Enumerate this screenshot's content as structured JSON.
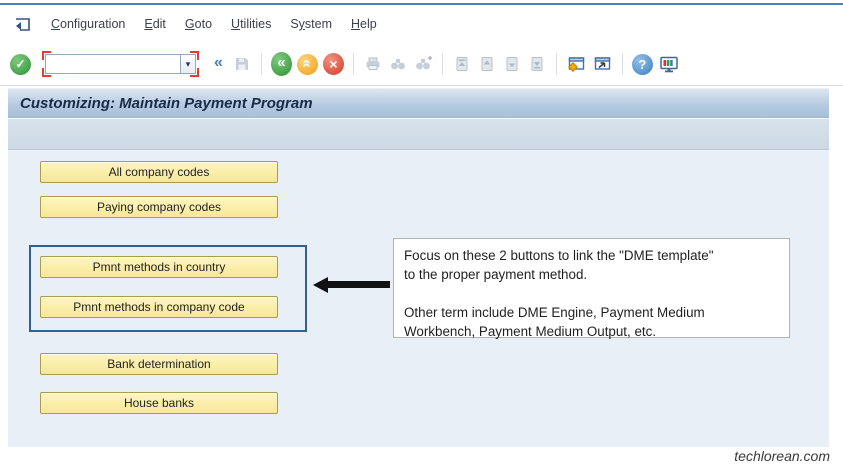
{
  "menu_bar": {
    "items": [
      {
        "pre": "",
        "key": "C",
        "post": "onfiguration"
      },
      {
        "pre": "",
        "key": "E",
        "post": "dit"
      },
      {
        "pre": "",
        "key": "G",
        "post": "oto"
      },
      {
        "pre": "",
        "key": "U",
        "post": "tilities"
      },
      {
        "pre": "S",
        "key": "y",
        "post": "stem"
      },
      {
        "pre": "",
        "key": "H",
        "post": "elp"
      }
    ]
  },
  "toolbar": {
    "command_field": {
      "value": ""
    },
    "glyphs": {
      "check": "✓",
      "chevrons_left": "«",
      "cross": "×",
      "question": "?",
      "dropdown": "▾"
    },
    "icon_names": [
      "enter",
      "command-field",
      "collapse",
      "save",
      "back",
      "exit",
      "cancel",
      "print",
      "find",
      "find-next",
      "first-page",
      "previous-page",
      "next-page",
      "last-page",
      "new-session",
      "create-shortcut",
      "help",
      "customize-layout"
    ]
  },
  "title_bar": {
    "title": "Customizing: Maintain Payment Program"
  },
  "content": {
    "buttons": [
      {
        "label": "All company codes",
        "highlighted": false
      },
      {
        "label": "Paying company codes",
        "highlighted": false
      },
      {
        "label": "Pmnt methods in country",
        "highlighted": true
      },
      {
        "label": "Pmnt methods in company code",
        "highlighted": true
      },
      {
        "label": "Bank determination",
        "highlighted": false
      },
      {
        "label": "House banks",
        "highlighted": false
      }
    ],
    "annotation": {
      "paragraph1": "Focus on these 2 buttons to link the \"DME template\"\nto the proper payment method.",
      "paragraph2": "Other term include DME Engine, Payment Medium\nWorkbench, Payment Medium Output, etc."
    }
  },
  "footer": {
    "watermark": "techlorean.com"
  },
  "colors": {
    "button_fill": "#f9ec9e",
    "button_border": "#a99b55",
    "highlight_box_border": "#33608f",
    "arrow": "#111111",
    "enter_green": "#2e9135",
    "exit_orange": "#ee9f12",
    "cancel_red": "#d13c28",
    "help_blue": "#3f7fbe",
    "title_band": "#aec5dc",
    "content_background": "#e9eff6"
  }
}
